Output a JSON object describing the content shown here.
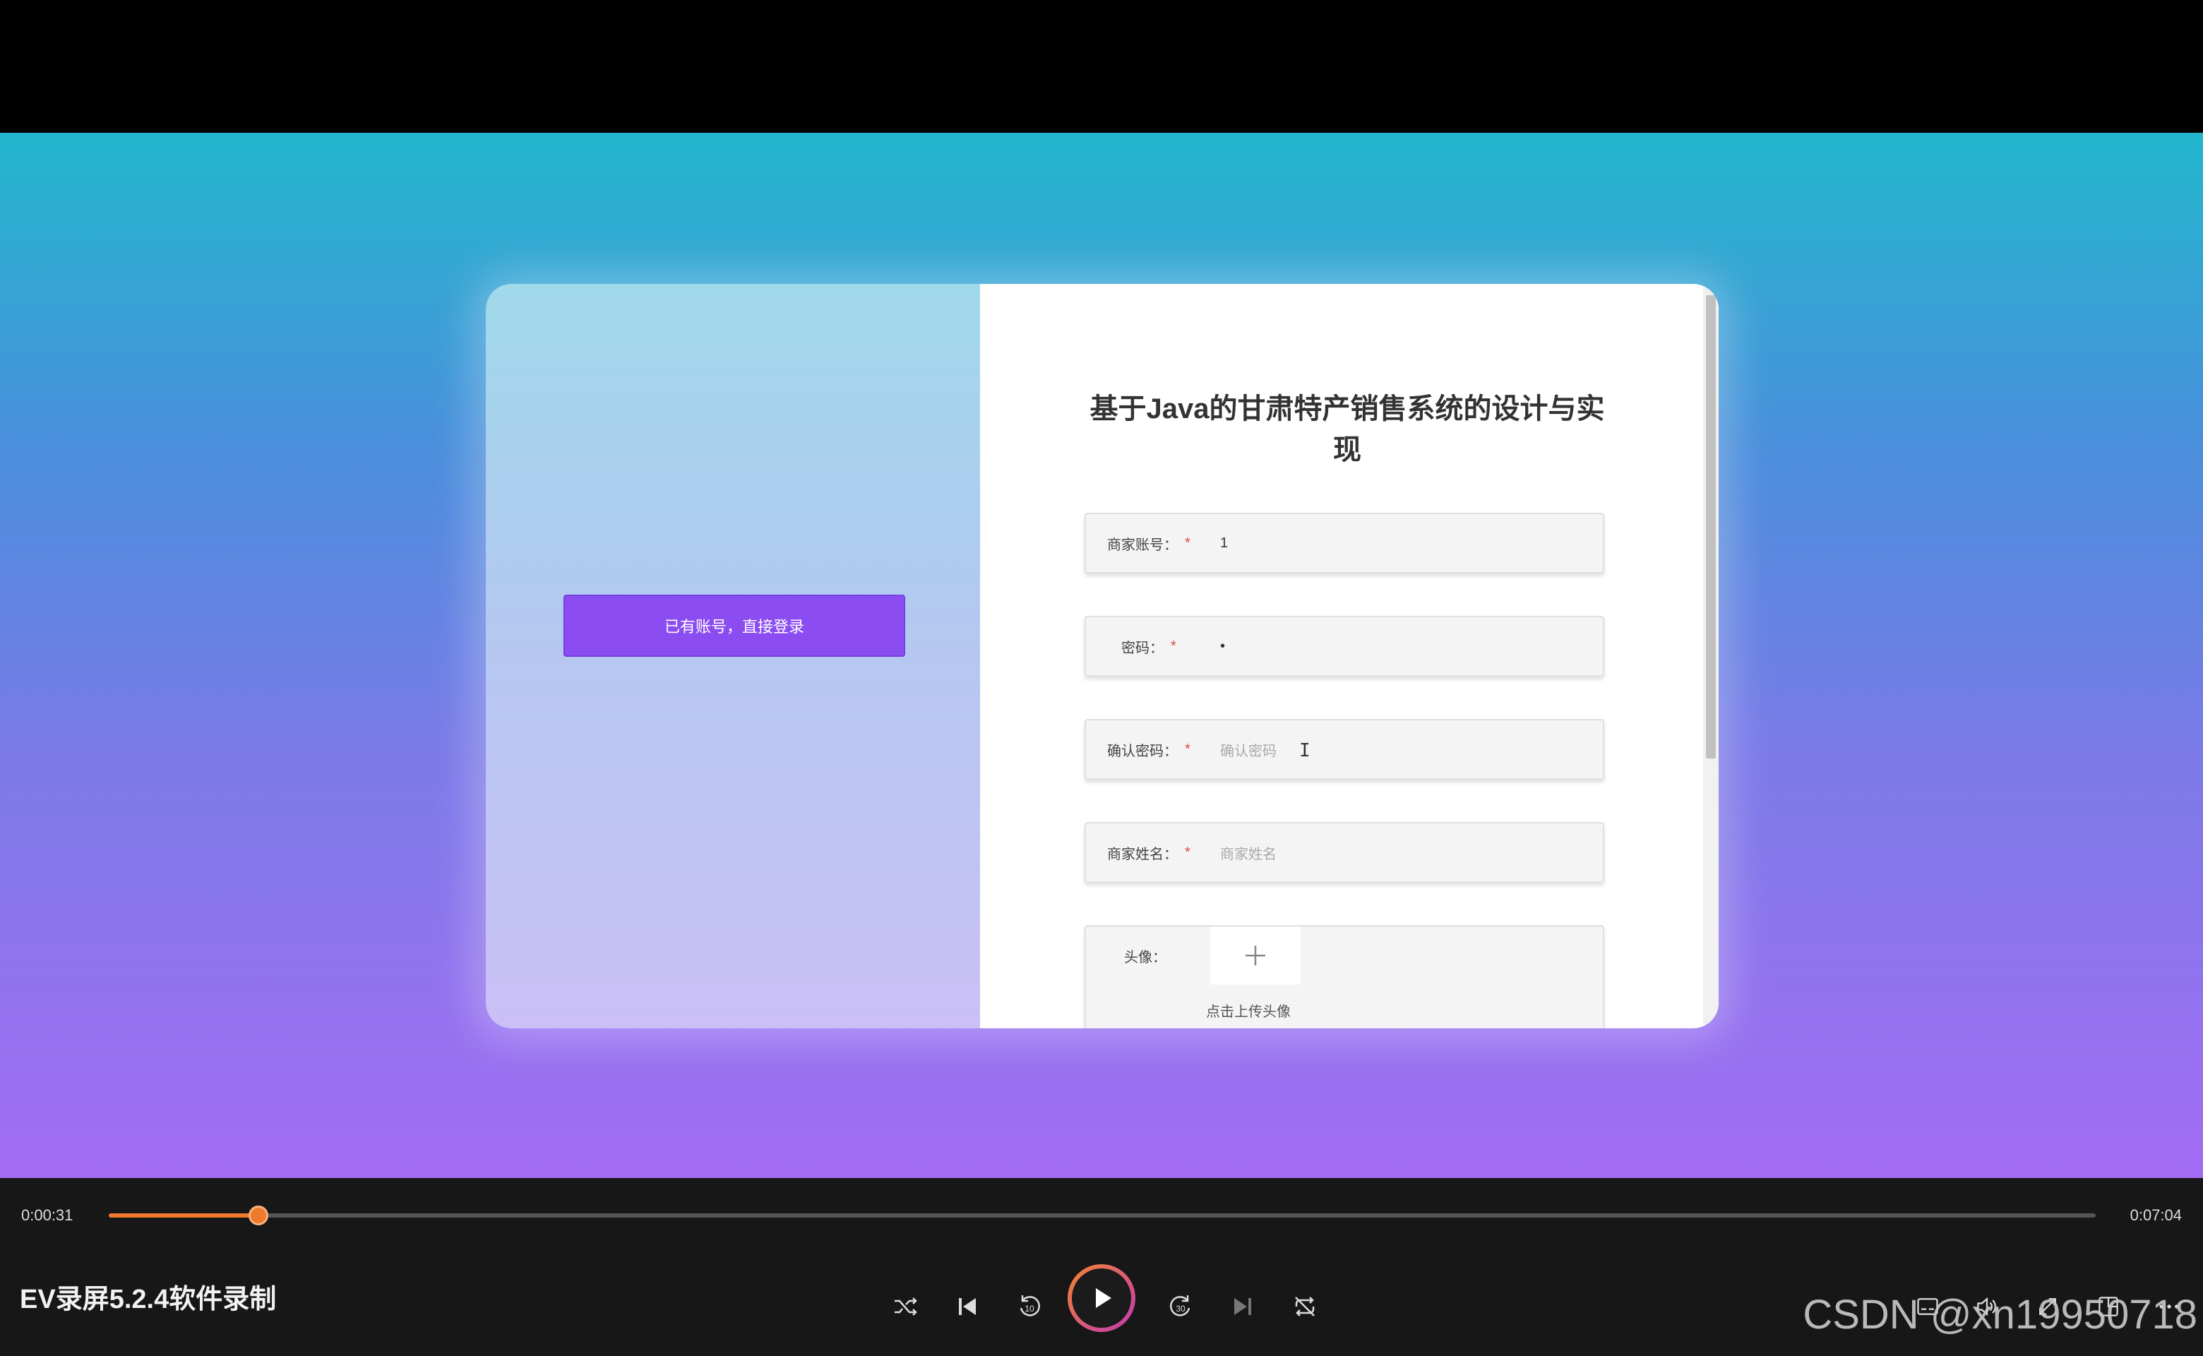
{
  "form": {
    "title": "基于Java的甘肃特产销售系统的设计与实现",
    "login_link_label": "已有账号，直接登录",
    "fields": [
      {
        "label": "商家账号：",
        "required": "*",
        "value": "1",
        "placeholder": ""
      },
      {
        "label": "密码：",
        "required": "*",
        "value": "•",
        "placeholder": ""
      },
      {
        "label": "确认密码：",
        "required": "*",
        "value": "",
        "placeholder": "确认密码"
      },
      {
        "label": "商家姓名：",
        "required": "*",
        "value": "",
        "placeholder": "商家姓名"
      }
    ],
    "avatar": {
      "label": "头像：",
      "upload_hint": "点击上传头像"
    }
  },
  "player": {
    "current_time": "0:00:31",
    "total_time": "0:07:04",
    "progress_fraction": 0.0755,
    "recorder_label": "EV录屏5.2.4软件录制",
    "controls": [
      "shuffle-icon",
      "previous-icon",
      "rewind-10-icon",
      "play-icon",
      "forward-30-icon",
      "next-icon",
      "repeat-off-icon",
      "subtitles-icon",
      "volume-icon",
      "fullscreen-icon",
      "mini-player-icon",
      "more-icon"
    ],
    "skip_back_seconds": "10",
    "skip_forward_seconds": "30"
  },
  "watermark": "CSDN @xn19950718",
  "colors": {
    "accent": "#f07a2c",
    "button": "#8b4df1",
    "required": "#e04848"
  }
}
